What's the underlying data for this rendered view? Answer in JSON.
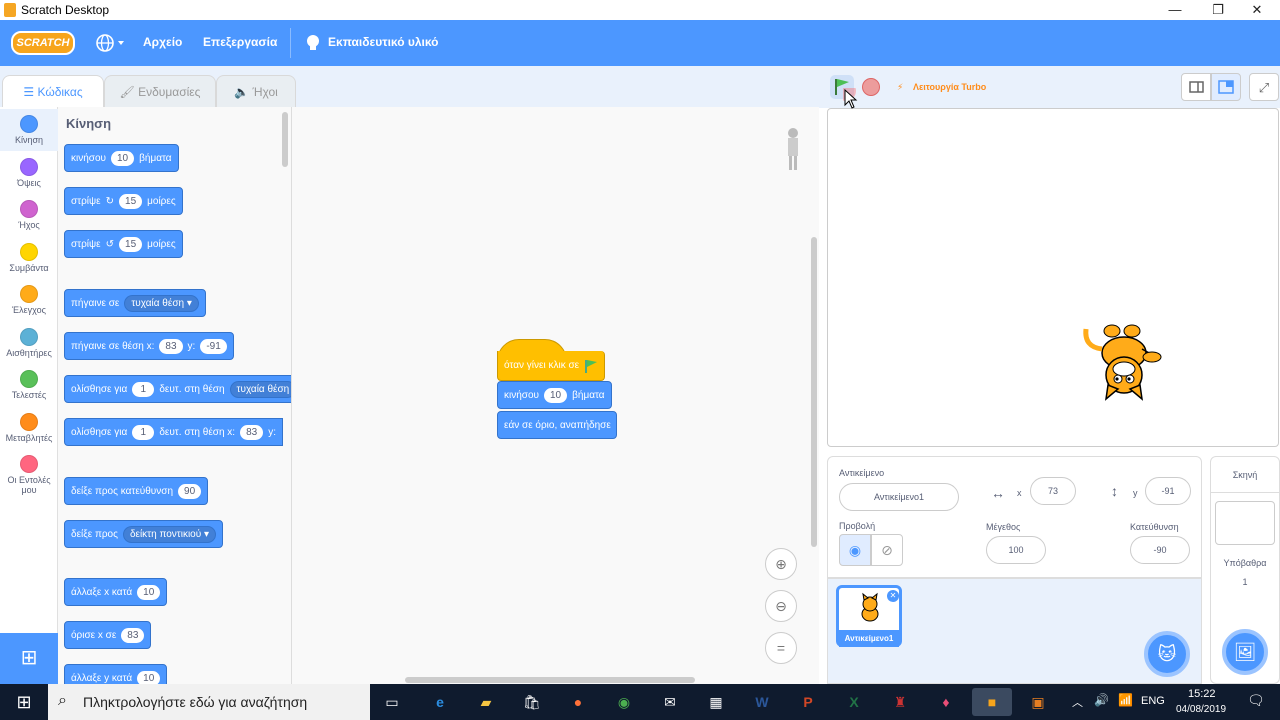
{
  "window": {
    "title": "Scratch Desktop",
    "controls": {
      "minimize": "—",
      "maximize": "❐",
      "close": "✕"
    }
  },
  "menubar": {
    "logo": "SCRATCH",
    "file": "Αρχείο",
    "edit": "Επεξεργασία",
    "tutorials": "Εκπαιδευτικό υλικό"
  },
  "tabs": [
    {
      "label": "Κώδικας"
    },
    {
      "label": "Ενδυμασίες"
    },
    {
      "label": "Ήχοι"
    }
  ],
  "categories": [
    {
      "label": "Κίνηση",
      "color": "#4c97ff"
    },
    {
      "label": "Όψεις",
      "color": "#9966ff"
    },
    {
      "label": "Ήχος",
      "color": "#cf63cf"
    },
    {
      "label": "Συμβάντα",
      "color": "#ffd500"
    },
    {
      "label": "Έλεγχος",
      "color": "#ffab19"
    },
    {
      "label": "Αισθητήρες",
      "color": "#5cb1d6"
    },
    {
      "label": "Τελεστές",
      "color": "#59c059"
    },
    {
      "label": "Μεταβλητές",
      "color": "#ff8c1a"
    },
    {
      "label": "Οι Εντολές",
      "label2": "μου",
      "color": "#ff6680"
    }
  ],
  "palette": {
    "title": "Κίνηση",
    "b1": {
      "t1": "κινήσου",
      "v": "10",
      "t2": "βήματα"
    },
    "b2": {
      "t1": "στρίψε",
      "v": "15",
      "t2": "μοίρες"
    },
    "b3": {
      "t1": "στρίψε",
      "v": "15",
      "t2": "μοίρες"
    },
    "b4": {
      "t1": "πήγαινε σε",
      "dd": "τυχαία θέση ▾"
    },
    "b5": {
      "t1": "πήγαινε σε θέση x:",
      "x": "83",
      "t2": "y:",
      "y": "-91"
    },
    "b6": {
      "t1": "ολίσθησε για",
      "v": "1",
      "t2": "δευτ. στη θέση",
      "dd": "τυχαία θέση"
    },
    "b7": {
      "t1": "ολίσθησε για",
      "v": "1",
      "t2": "δευτ. στη θέση x:",
      "x": "83",
      "t3": "y:"
    },
    "b8": {
      "t1": "δείξε προς κατεύθυνση",
      "v": "90"
    },
    "b9": {
      "t1": "δείξε προς",
      "dd": "δείκτη ποντικιού ▾"
    },
    "b10": {
      "t1": "άλλαξε x κατά",
      "v": "10"
    },
    "b11": {
      "t1": "όρισε x σε",
      "v": "83"
    },
    "b12": {
      "t1": "άλλαξε y κατά",
      "v": "10"
    }
  },
  "script": {
    "hat": "όταν γίνει κλικ σε",
    "move": {
      "t1": "κινήσου",
      "v": "10",
      "t2": "βήματα"
    },
    "bounce": "εάν σε όριο, αναπήδησε"
  },
  "stage_header": {
    "turbo": "Λειτουργία Turbo"
  },
  "sprite_info": {
    "sprite_label": "Αντικείμενο",
    "sprite_name": "Αντικείμενο1",
    "x_label": "x",
    "x": "73",
    "y_label": "y",
    "y": "-91",
    "show_label": "Προβολή",
    "size_label": "Μέγεθος",
    "size": "100",
    "direction_label": "Κατεύθυνση",
    "direction": "-90"
  },
  "sprite_list": [
    {
      "name": "Αντικείμενο1"
    }
  ],
  "stage_panel": {
    "title": "Σκηνή",
    "backdrops_label": "Υπόβαθρα",
    "backdrops_count": "1"
  },
  "taskbar": {
    "search_placeholder": "Πληκτρολογήστε εδώ για αναζήτηση",
    "lang": "ENG",
    "time": "15:22",
    "date": "04/08/2019"
  }
}
